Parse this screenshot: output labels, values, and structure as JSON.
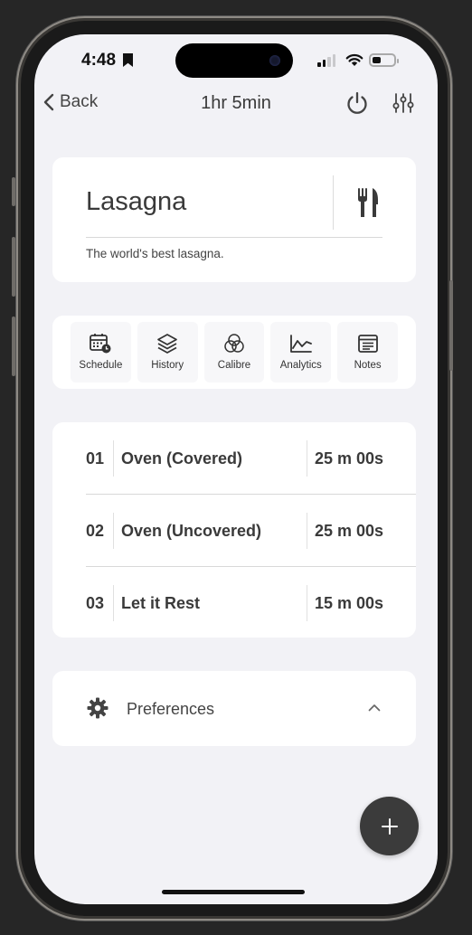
{
  "status_bar": {
    "time": "4:48"
  },
  "nav": {
    "back_label": "Back",
    "title": "1hr 5min"
  },
  "recipe": {
    "name": "Lasagna",
    "description": "The world's best lasagna."
  },
  "tools": [
    {
      "label": "Schedule",
      "icon": "calendar-clock-icon"
    },
    {
      "label": "History",
      "icon": "layers-icon"
    },
    {
      "label": "Calibre",
      "icon": "circles-icon"
    },
    {
      "label": "Analytics",
      "icon": "line-chart-icon"
    },
    {
      "label": "Notes",
      "icon": "notes-icon"
    }
  ],
  "steps": [
    {
      "number": "01",
      "name": "Oven (Covered)",
      "time": "25 m 00s"
    },
    {
      "number": "02",
      "name": "Oven (Uncovered)",
      "time": "25 m 00s"
    },
    {
      "number": "03",
      "name": "Let it Rest",
      "time": "15 m 00s"
    }
  ],
  "preferences": {
    "label": "Preferences",
    "icon": "gear-icon",
    "chevron": "chevron-up-icon"
  },
  "fab": {
    "icon": "plus-icon"
  },
  "colors": {
    "background": "#f2f2f6",
    "card": "#ffffff",
    "fab": "#3b3b3b"
  }
}
